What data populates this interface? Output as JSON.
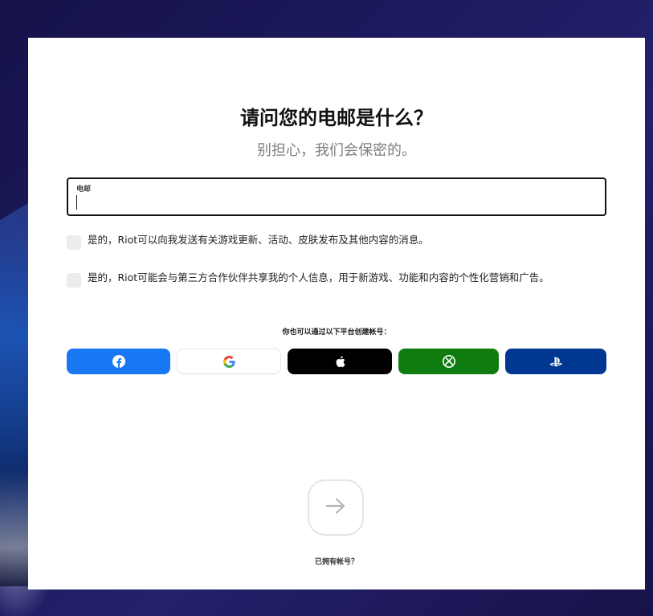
{
  "form": {
    "title": "请问您的电邮是什么？",
    "subtitle": "别担心，我们会保密的。",
    "email_label": "电邮",
    "email_value": "",
    "checkbox_updates_label": "是的，Riot可以向我发送有关游戏更新、活动、皮肤发布及其他内容的消息。",
    "checkbox_updates_checked": false,
    "checkbox_share_label": "是的，Riot可能会与第三方合作伙伴共享我的个人信息，用于新游戏、功能和内容的个性化营销和广告。",
    "checkbox_share_checked": false,
    "alt_signup_text": "你也可以通过以下平台创建帐号：",
    "have_account_link": "已拥有帐号？"
  },
  "social_buttons": [
    {
      "icon": "facebook-icon",
      "color": "#1877f2"
    },
    {
      "icon": "google-icon",
      "color": "#ffffff"
    },
    {
      "icon": "apple-icon",
      "color": "#000000"
    },
    {
      "icon": "xbox-icon",
      "color": "#107c10"
    },
    {
      "icon": "playstation-icon",
      "color": "#003791"
    }
  ],
  "next_button": {
    "icon": "arrow-right-icon"
  }
}
